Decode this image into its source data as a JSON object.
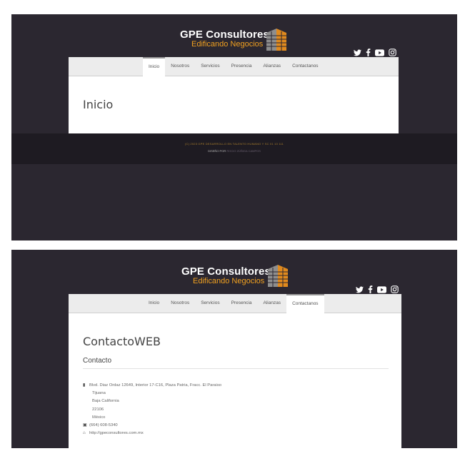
{
  "brand": {
    "title": "GPE Consultores",
    "tagline": "Edificando Negocios"
  },
  "colors": {
    "background": "#2b2730",
    "accent": "#f0a020",
    "footer": "#1e1b22"
  },
  "social": [
    "twitter-icon",
    "facebook-icon",
    "youtube-icon",
    "instagram-icon"
  ],
  "nav": {
    "items": [
      "Inicio",
      "Nosotros",
      "Servicios",
      "Presencia",
      "Alianzas",
      "Contactanos"
    ]
  },
  "screen1": {
    "active_tab": "Inicio",
    "page_title": "Inicio",
    "footer_line1": "(C) 2023 GPE DESARROLLO EN TALENTO HUMANO Y SC 01 10 111",
    "footer_line2_prefix": "DISEÑO POR",
    "footer_line2_link": "ROCIO ZÚÑIGA CAMPOS"
  },
  "screen2": {
    "active_tab": "Contactanos",
    "page_title": "ContactoWEB",
    "section_title": "Contacto",
    "address_line1": "Blvd. Diaz Ordaz 12649, Interior 17-C16, Plaza Patria, Fracc. El Paraiso",
    "city": "Tijuana",
    "state": "Baja California",
    "zip": "22106",
    "country": "México",
    "phone": "(664) 608-5340",
    "website": "http://gpeconsultores.com.mx"
  }
}
